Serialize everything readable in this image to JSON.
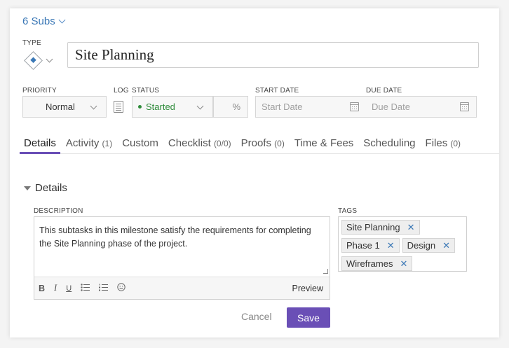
{
  "header": {
    "subs_label": "6 Subs"
  },
  "labels": {
    "type": "TYPE",
    "priority": "PRIORITY",
    "log": "LOG",
    "status": "STATUS",
    "start_date": "START DATE",
    "due_date": "DUE DATE",
    "description": "DESCRIPTION",
    "tags": "TAGS"
  },
  "task": {
    "title": "Site Planning"
  },
  "fields": {
    "priority": "Normal",
    "status": "Started",
    "percent": "%",
    "start_date_placeholder": "Start Date",
    "due_date_placeholder": "Due Date"
  },
  "tabs": [
    {
      "label": "Details",
      "count": ""
    },
    {
      "label": "Activity",
      "count": "(1)"
    },
    {
      "label": "Custom",
      "count": ""
    },
    {
      "label": "Checklist",
      "count": "(0/0)"
    },
    {
      "label": "Proofs",
      "count": "(0)"
    },
    {
      "label": "Time & Fees",
      "count": ""
    },
    {
      "label": "Scheduling",
      "count": ""
    },
    {
      "label": "Files",
      "count": "(0)"
    }
  ],
  "details": {
    "section_title": "Details",
    "description": "This subtasks in this milestone satisfy the requirements for completing the Site Planning phase of the project.",
    "toolbar": {
      "bold": "B",
      "italic": "I",
      "underline": "U",
      "preview": "Preview"
    }
  },
  "tags": [
    "Site Planning",
    "Phase 1",
    "Design",
    "Wireframes"
  ],
  "actions": {
    "cancel": "Cancel",
    "save": "Save"
  },
  "colors": {
    "accent": "#6a4fb6",
    "link": "#3b78b6",
    "status_started": "#2e8b3a"
  }
}
